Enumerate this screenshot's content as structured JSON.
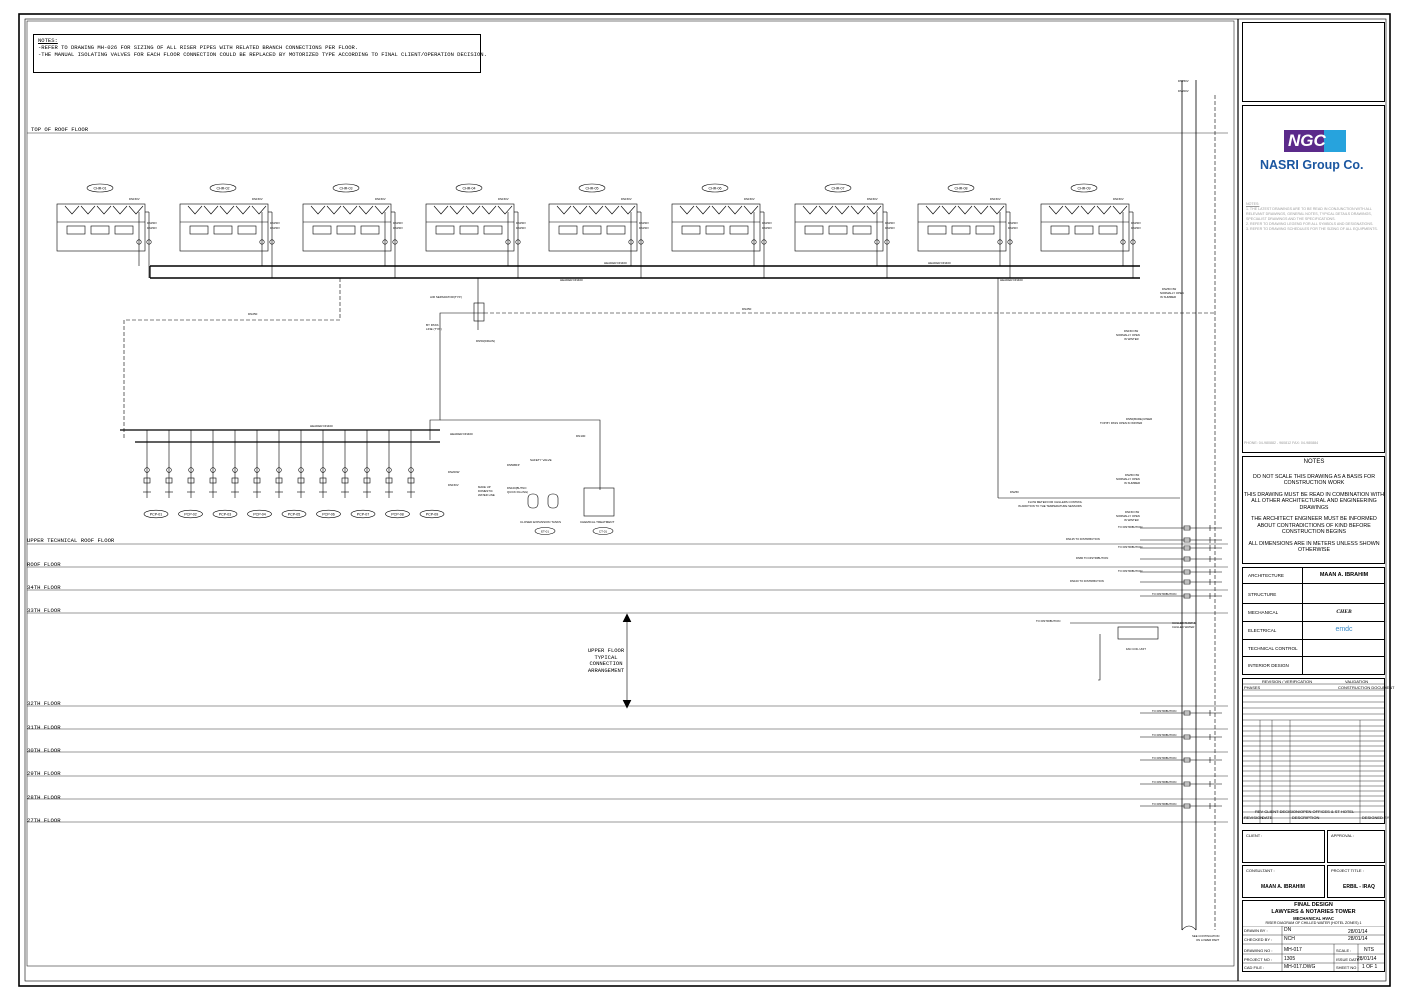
{
  "notes": {
    "title": "NOTES:",
    "line1": "-REFER TO DRAWING MH-026 FOR SIZING OF ALL RISER PIPES WITH RELATED BRANCH CONNECTIONS PER FLOOR.",
    "line2": "-THE MANUAL ISOLATING VALVES FOR EACH FLOOR CONNECTION COULD BE REPLACED BY MOTORIZED TYPE ACCORDING TO FINAL CLIENT/OPERATION DECISION."
  },
  "floors": {
    "top_roof": "TOP OF ROOF FLOOR",
    "upper_tech": "UPPER TECHNICAL ROOF FLOOR",
    "roof": "ROOF FLOOR",
    "f34": "34TH FLOOR",
    "f33": "33TH FLOOR",
    "f32": "32TH FLOOR",
    "f31": "31TH FLOOR",
    "f30": "30TH FLOOR",
    "f29": "29TH FLOOR",
    "f28": "28TH FLOOR",
    "f27": "27TH FLOOR"
  },
  "drawing": {
    "chillers": [
      "CHR-01",
      "CHR-02",
      "CHR-03",
      "CHR-04",
      "CHR-05",
      "CHR-06",
      "CHR-07",
      "CHR-08",
      "CHR-09"
    ],
    "pumps": [
      "PCP-01",
      "PCP-02",
      "PCP-03",
      "PCP-04",
      "PCP-05",
      "PCP-06",
      "PCP-07",
      "PCP-08",
      "PCP-09"
    ],
    "header_label": "HEADER DN400",
    "air_sep": "AIR SEPARATOR(TYP.)",
    "bypass": "BY PASS LINE (TYP.)",
    "drain": "DN50(DRAIN)",
    "dn250": "DN250",
    "dn100": "DN100",
    "safety_valve": "SAFETY VALVE",
    "makeup": "MAKE UP DOMESTIC WATER LINE",
    "quick_fill": "DN100(BUTNO QUICK FILLING)",
    "exp_tanks": "CLOSED EXPANSION TANKS",
    "chem_treat": "CHEMICAL TREATMENT",
    "et_tag": "ET-01",
    "ct_tag": "CT-01",
    "valve_summer": "DN250 NW NORMALLY OPEN IN SUMMER",
    "valve_winter": "DN150 NW NORMALLY OPEN IN WINTER",
    "bypass_winter": "DN50(BURE) RISER TOP BY PASS OPEN IN WINTER",
    "flow_meter": "FLOW METER FOR CHILLERS CONTROL IN ADDITION TO THE TEMPERATURE SENSORS",
    "dn250_summer": "DN250 NW NORMALLY OPEN IN SUMMER",
    "dn150_winter": "DN150 NW NORMALLY OPEN IN WINTER",
    "to_distribution": "TO DISTRIBUTION",
    "dn125": "DN125 TO DISTRIBUTION",
    "dn80": "DN80 TO DISTRIBUTION",
    "dn100_dist": "DN100 TO DISTRIBUTION",
    "chilled_water": "CHILLED FLOW & CHILLED WATER",
    "fan_coil": "FAN COIL UNIT",
    "typical_1": "UPPER FLOOR",
    "typical_2": "TYPICAL",
    "typical_3": "CONNECTION",
    "typical_4": "ARRANGEMENT",
    "continuation": "SEE CONTINUATION ON LOWER PART",
    "dn200": "DN200W",
    "dn150v": "DN150V"
  },
  "titleblock": {
    "company": "NASRI Group Co.",
    "logo": "NGC",
    "notes_head": "NOTES",
    "n1": "DO NOT SCALE THIS DRAWING AS A BASIS FOR CONSTRUCTION WORK",
    "n2": "THIS DRAWING MUST BE READ IN COMBINATION WITH ALL OTHER ARCHITECTURAL AND ENGINEERING DRAWINGS",
    "n3": "THE ARCHITECT ENGINEER MUST BE INFORMED ABOUT CONTRADICTIONS OF KIND BEFORE CONSTRUCTION BEGINS",
    "n4": "ALL DIMENSIONS ARE IN METERS UNLESS SHOWN OTHERWISE",
    "architecture": "ARCHITECTURE",
    "architect_name": "MAAN A. IBRAHIM",
    "structure": "STRUCTURE",
    "mechanical": "MECHANICAL",
    "mech_logo": "CHEB",
    "electrical": "ELECTRICAL",
    "elec_logo": "emdc",
    "technical": "TECHNICAL CONTROL",
    "interior": "INTERIOR DESIGN",
    "client": "CLIENT :",
    "approval": "APPROVAL :",
    "consultant": "CONSULTANT :",
    "consultant_name": "MAAN A. IBRAHIM",
    "project_title": "PROJECT TITLE :",
    "project_loc": "ERBIL - IRAQ",
    "stage": "FINAL DESIGN",
    "project_name": "LAWYERS & NOTARIES TOWER",
    "discipline": "MECHANICAL HVAC",
    "sheet_desc": "RISER DIAGRAM OF CHILLED WATER (HOTEL ZONES) 1",
    "drawn_by_lbl": "DRAWN BY :",
    "drawn_by": "DN",
    "checked_lbl": "CHECKED BY :",
    "checked_by": "NCH",
    "date1": "28/01/14",
    "date2": "28/01/14",
    "drawing_no_lbl": "DRAWING NO :",
    "drawing_no": "MH-017",
    "scale_lbl": "SCALE :",
    "scale": "NTS",
    "project_no_lbl": "PROJECT NO :",
    "project_no": "1305",
    "issue_lbl": "ISSUE DATE :",
    "issue_date": "28/01/14",
    "cad_lbl": "CAD FILE :",
    "cad_file": "MH-017.DWG",
    "sheet_lbl": "SHEET NO :",
    "sheet_no": "1 OF 1",
    "revision_lbl": "REVISION",
    "date_lbl": "DATE",
    "description_lbl": "DESCRIPTION",
    "designed_lbl": "DESIGNED BY",
    "rev_row": "REV CLIENT DECISION/OPEN OFFICES & ST HOTEL",
    "verification": "REVISION / VERIFICATION",
    "validation": "VALIDATION",
    "construction": "CONSTRUCTION DOCUMENT",
    "phases": "PHASES",
    "grey_phone": "PHONE: 04-980882 - 960812    FAX: 04-980884"
  }
}
